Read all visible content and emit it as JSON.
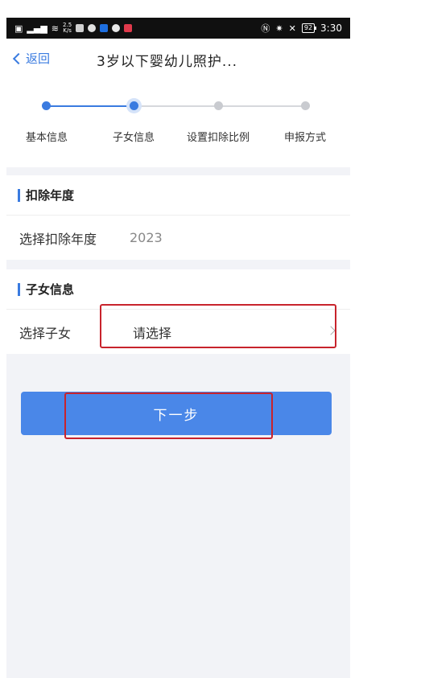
{
  "status_bar": {
    "left_icons": [
      "sim-icon",
      "signal-icon",
      "wifi-icon"
    ],
    "net_speed_value": "2.5",
    "net_speed_unit": "K/s",
    "right_battery": "92",
    "time": "3:30"
  },
  "nav": {
    "back_label": "返回",
    "title": "3岁以下婴幼儿照护..."
  },
  "stepper": {
    "steps": [
      {
        "label": "基本信息",
        "state": "done"
      },
      {
        "label": "子女信息",
        "state": "current"
      },
      {
        "label": "设置扣除比例",
        "state": "todo"
      },
      {
        "label": "申报方式",
        "state": "todo"
      }
    ]
  },
  "deduction_year": {
    "title": "扣除年度",
    "row_label": "选择扣除年度",
    "row_value": "2023"
  },
  "child_info": {
    "title": "子女信息",
    "row_label": "选择子女",
    "row_placeholder": "请选择"
  },
  "next_button": {
    "label": "下一步"
  },
  "colors": {
    "accent": "#3a7be0",
    "button": "#4a87e8",
    "highlight": "#c8232c"
  }
}
